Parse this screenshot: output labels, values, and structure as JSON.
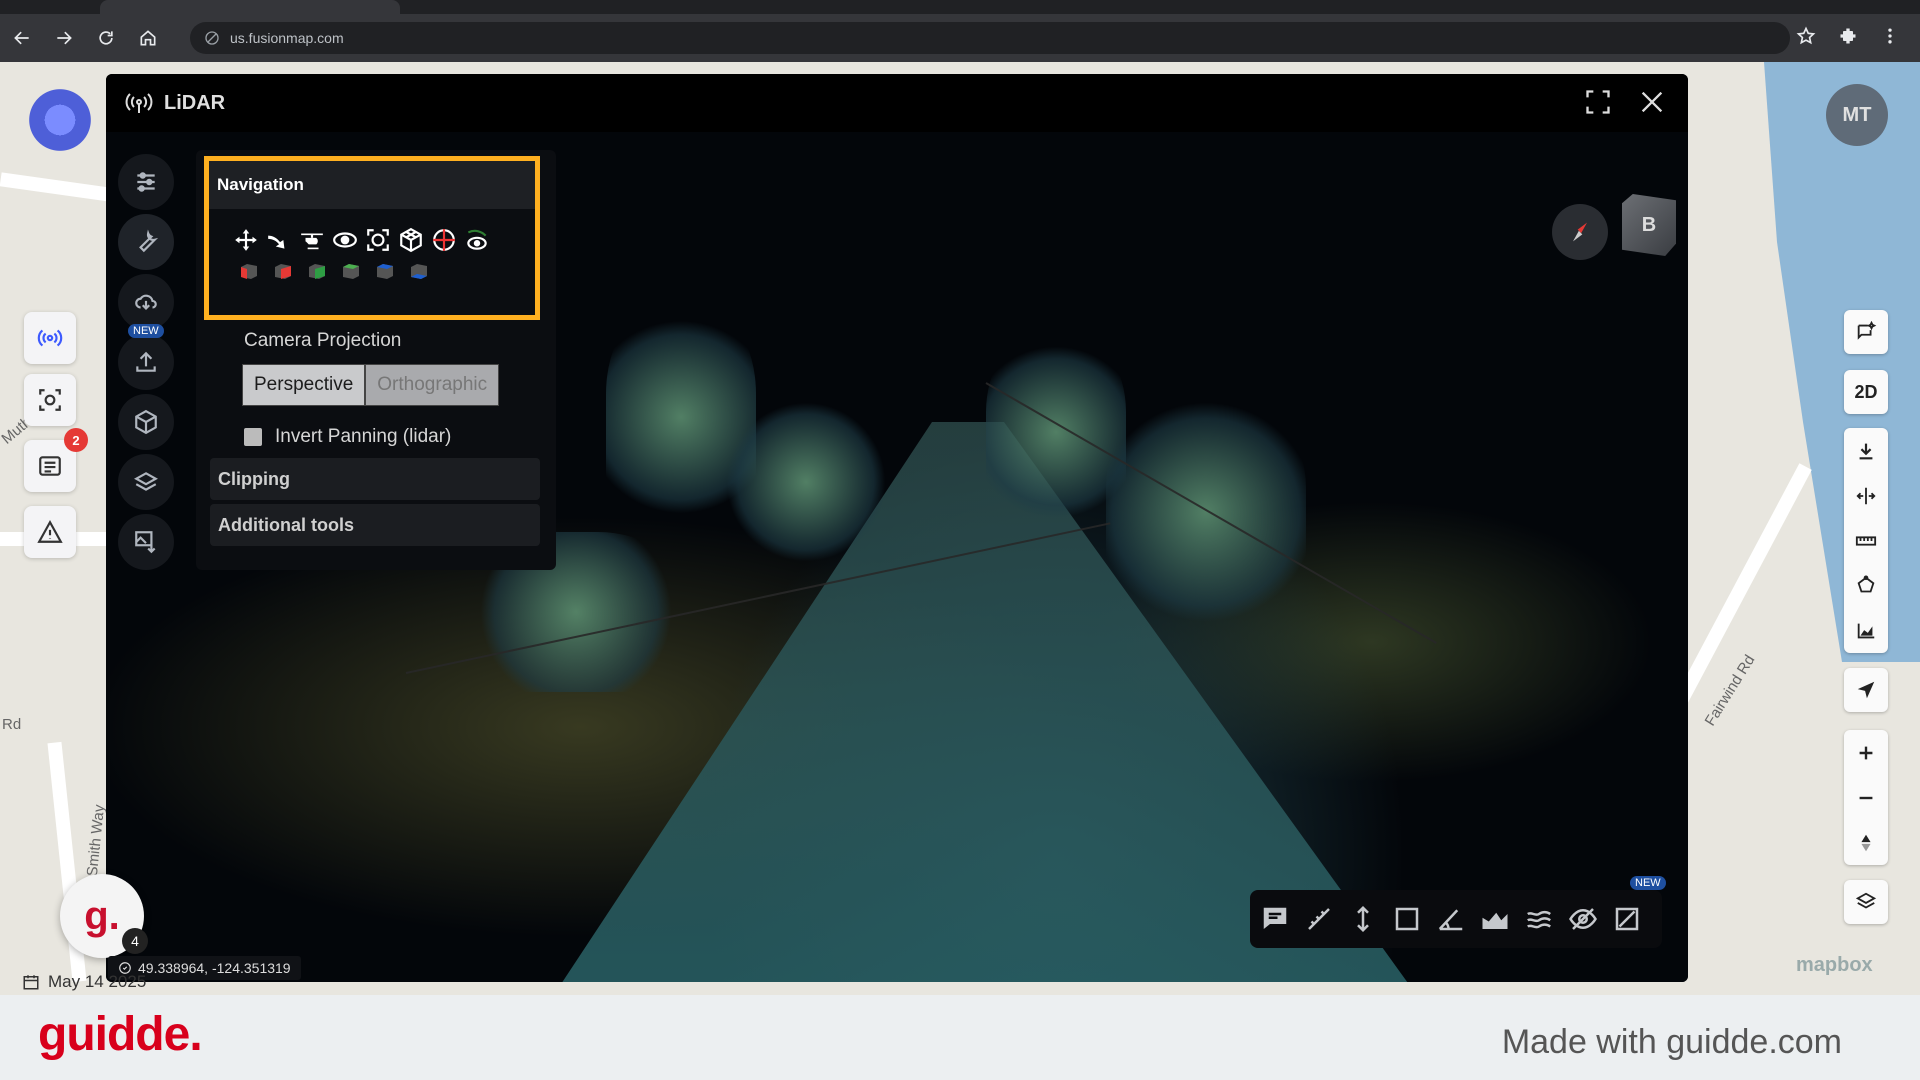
{
  "browser": {
    "url": "us.fusionmap.com"
  },
  "map": {
    "labels": [
      "Rd",
      "Fairwind Rd",
      "Smith Way",
      "Muth"
    ],
    "attribution": "mapbox"
  },
  "left_rail": {
    "messages_badge": "2"
  },
  "user": {
    "initials": "MT"
  },
  "right_rail": {
    "mode_label": "2D"
  },
  "lidar": {
    "title": "LiDAR",
    "side_new_badge": "NEW",
    "navigation": {
      "title": "Navigation",
      "nav_icons": [
        "pan-icon",
        "fly-icon",
        "helicopter-icon",
        "orbit-icon",
        "focus-icon",
        "cube-view-icon",
        "earth-control-icon",
        "look-icon"
      ],
      "view_cubes": [
        "left",
        "front",
        "right",
        "back",
        "top",
        "bottom"
      ]
    },
    "camera_projection": {
      "label": "Camera Projection",
      "options": [
        "Perspective",
        "Orthographic"
      ],
      "selected": "Perspective"
    },
    "invert_panning": {
      "label": "Invert Panning (lidar)",
      "checked": false
    },
    "sections": [
      "Clipping",
      "Additional tools"
    ],
    "viewcube_face": "B",
    "measure_new_badge": "NEW"
  },
  "status": {
    "coordinates": "49.338964, -124.351319",
    "date": "May 14 2025",
    "guidde_count": "4"
  },
  "footer": {
    "brand": "guidde.",
    "made_with": "Made with guidde.com"
  },
  "colors": {
    "highlight": "#ffb020",
    "brand_red": "#d8001c",
    "accent_blue": "#3d5afe"
  }
}
